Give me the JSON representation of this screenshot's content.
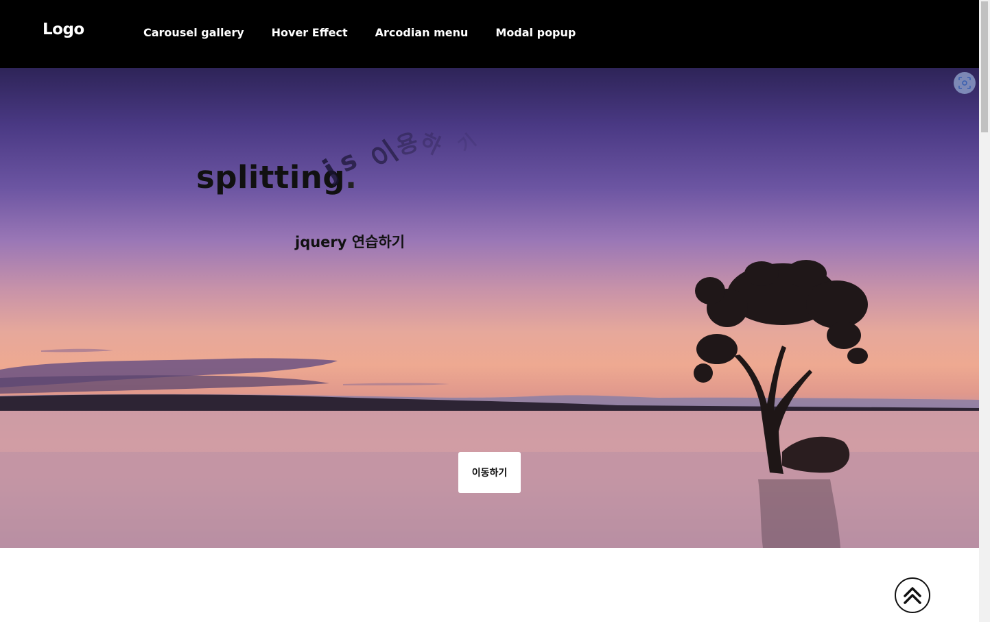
{
  "header": {
    "logo": "Logo",
    "nav": [
      {
        "label": "Carousel gallery"
      },
      {
        "label": "Hover Effect"
      },
      {
        "label": "Arcodian menu"
      },
      {
        "label": "Modal popup"
      }
    ]
  },
  "hero": {
    "title_main": "splitting",
    "title_dot": ".",
    "title_scatter": [
      "j",
      "s",
      "이",
      "용",
      "하",
      "기"
    ],
    "subtitle": "jquery 연습하기",
    "move_button": "이동하기"
  },
  "icons": {
    "scan": "scan-icon",
    "top": "double-chevron-up-icon"
  }
}
